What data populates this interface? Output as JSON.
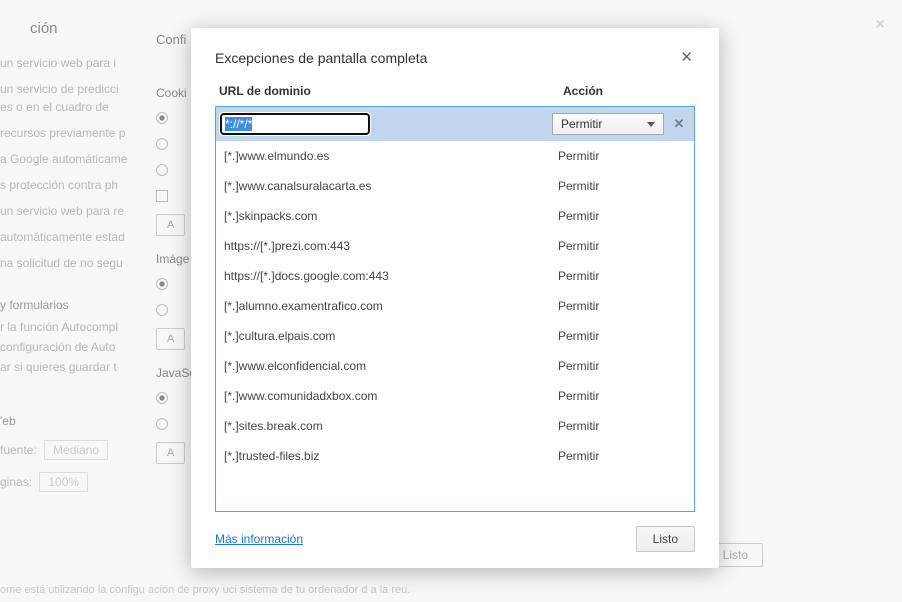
{
  "bg": {
    "title_fragment": "ción",
    "config_title": "Confi",
    "lines": [
      "un servicio web para i",
      "un servicio de predicci",
      "es o en el cuadro de",
      "recursos previamente p",
      "a Google automáticame",
      "s protección contra ph",
      "un servicio web para re",
      "automáticamente estad",
      "na solicitud de no segu"
    ],
    "cookies_label": "Cooki",
    "images_label": "Imáge",
    "forms_label": "y formularios",
    "forms_lines": [
      "r la función Autocompl",
      "configuración de Auto",
      "ar si quieres guardar t"
    ],
    "js_label": "JavaSc",
    "web_label": "'eb",
    "fuente_label": "fuente:",
    "fuente_value": "Mediano",
    "ginas_label": "ginas:",
    "ginas_value": "100%",
    "bottom_line": "ome está utilizando la configu ación de proxy uci sistema de tu ordenador d a la reu.",
    "a_button": "A",
    "listo": "Listo"
  },
  "modal": {
    "title": "Excepciones de pantalla completa",
    "col_domain": "URL de dominio",
    "col_action": "Acción",
    "input_value": "*://*/*",
    "select_label": "Permitir",
    "rows": [
      {
        "domain": "[*.]www.elmundo.es",
        "action": "Permitir"
      },
      {
        "domain": "[*.]www.canalsuralacarta.es",
        "action": "Permitir"
      },
      {
        "domain": "[*.]skinpacks.com",
        "action": "Permitir"
      },
      {
        "domain": "https://[*.]prezi.com:443",
        "action": "Permitir"
      },
      {
        "domain": "https://[*.]docs.google.com:443",
        "action": "Permitir"
      },
      {
        "domain": "[*.]alumno.examentrafico.com",
        "action": "Permitir"
      },
      {
        "domain": "[*.]cultura.elpais.com",
        "action": "Permitir"
      },
      {
        "domain": "[*.]www.elconfidencial.com",
        "action": "Permitir"
      },
      {
        "domain": "[*.]www.comunidadxbox.com",
        "action": "Permitir"
      },
      {
        "domain": "[*.]sites.break.com",
        "action": "Permitir"
      },
      {
        "domain": "[*.]trusted-files.biz",
        "action": "Permitir"
      }
    ],
    "more_info": "Más información",
    "done": "Listo"
  }
}
